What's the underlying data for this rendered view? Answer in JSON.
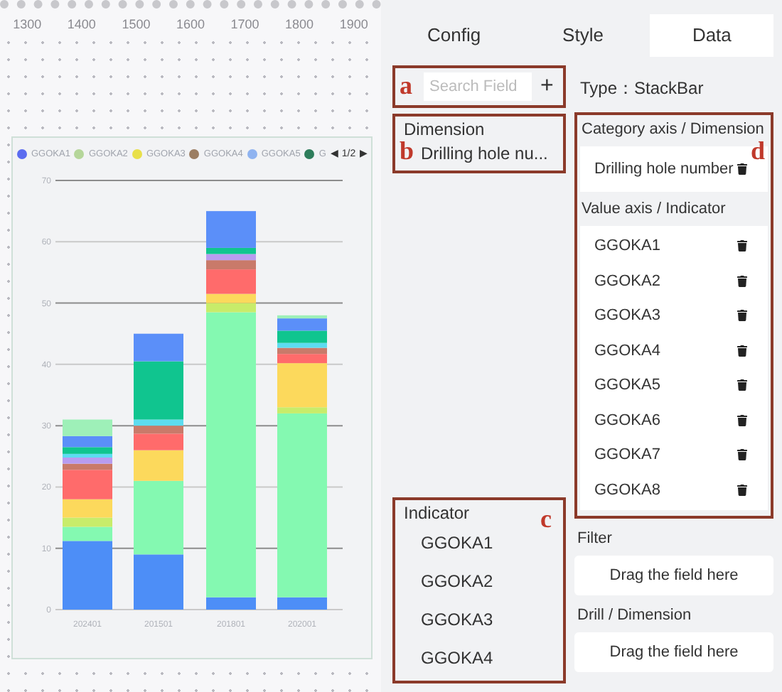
{
  "ruler": {
    "labels": [
      "1300",
      "1400",
      "1500",
      "1600",
      "1700",
      "1800",
      "1900"
    ]
  },
  "chart": {
    "legend": {
      "items": [
        {
          "label": "GGOKA1",
          "color": "#5b6cf0"
        },
        {
          "label": "GGOKA2",
          "color": "#b5d69a"
        },
        {
          "label": "GGOKA3",
          "color": "#e8e04a"
        },
        {
          "label": "GGOKA4",
          "color": "#9c7e63"
        },
        {
          "label": "GGOKA5",
          "color": "#8fb3f0"
        },
        {
          "label": "G",
          "color": "#2e7d5b"
        }
      ],
      "page": "1/2",
      "prev": "◀",
      "next": "▶"
    },
    "chart_data": {
      "type": "bar",
      "stacked": true,
      "grid": true,
      "categories": [
        "202401",
        "201501",
        "201801",
        "202001"
      ],
      "ylim": [
        0,
        70
      ],
      "yticks": [
        0,
        10,
        20,
        30,
        40,
        50,
        60,
        70
      ],
      "series": [
        {
          "color": "#4d8ef7",
          "values": [
            11.2,
            9,
            2,
            2
          ]
        },
        {
          "color": "#84f9b1",
          "values": [
            2.3,
            12,
            46.5,
            30
          ]
        },
        {
          "color": "#c8ec6a",
          "values": [
            1.5,
            0,
            1.5,
            1
          ]
        },
        {
          "color": "#fcd95c",
          "values": [
            3,
            5,
            1.5,
            7.2
          ]
        },
        {
          "color": "#ff6b6b",
          "values": [
            4.8,
            2.7,
            4,
            1.5
          ]
        },
        {
          "color": "#c97a6a",
          "values": [
            1,
            1.3,
            1.5,
            1
          ]
        },
        {
          "color": "#b89cf0",
          "values": [
            1,
            0,
            1,
            0
          ]
        },
        {
          "color": "#5ddcf0",
          "values": [
            0.6,
            1,
            0,
            0.8
          ]
        },
        {
          "color": "#10c58f",
          "values": [
            1.1,
            9.5,
            1,
            2
          ]
        },
        {
          "color": "#5b8ff9",
          "values": [
            1.8,
            4.5,
            6,
            2
          ]
        },
        {
          "color": "#9ef0b8",
          "values": [
            2.7,
            0,
            0,
            0.5
          ]
        }
      ]
    }
  },
  "tabs": [
    {
      "label": "Config",
      "selected": false
    },
    {
      "label": "Style",
      "selected": false
    },
    {
      "label": "Data",
      "selected": true
    }
  ],
  "search": {
    "placeholder": "Search Field",
    "add": "+",
    "marker": "a"
  },
  "dimension": {
    "title": "Dimension",
    "items": [
      "Drilling hole nu..."
    ],
    "marker": "b"
  },
  "indicator": {
    "title": "Indicator",
    "items": [
      "GGOKA1",
      "GGOKA2",
      "GGOKA3",
      "GGOKA4"
    ],
    "marker": "c"
  },
  "type": {
    "label": "Type：",
    "value": "StackBar"
  },
  "axes": {
    "marker": "d",
    "category_title": "Category axis / Dimension",
    "category_items": [
      "Drilling hole number"
    ],
    "value_title": "Value axis / Indicator",
    "value_items": [
      "GGOKA1",
      "GGOKA2",
      "GGOKA3",
      "GGOKA4",
      "GGOKA5",
      "GGOKA6",
      "GGOKA7",
      "GGOKA8"
    ]
  },
  "filter": {
    "title": "Filter",
    "placeholder": "Drag the field here"
  },
  "drill": {
    "title": "Drill / Dimension",
    "placeholder": "Drag the field here"
  }
}
